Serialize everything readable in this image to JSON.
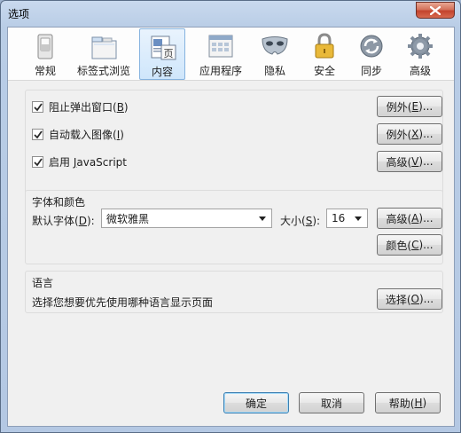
{
  "window": {
    "title": "选项"
  },
  "toolbar": {
    "tabs": [
      {
        "label": "常规"
      },
      {
        "label": "标签式浏览"
      },
      {
        "label": "内容"
      },
      {
        "label": "应用程序"
      },
      {
        "label": "隐私"
      },
      {
        "label": "安全"
      },
      {
        "label": "同步"
      },
      {
        "label": "高级"
      }
    ],
    "selected": "内容"
  },
  "popups": {
    "block_popups": {
      "label_pre": "阻止弹出窗口(",
      "key": "B",
      "label_post": ")",
      "checked": true
    },
    "load_images": {
      "label_pre": "自动载入图像(",
      "key": "I",
      "label_post": ")",
      "checked": true
    },
    "javascript": {
      "label_pre": "启用 ",
      "key": "J",
      "label_post": "avaScript",
      "checked": true
    },
    "exceptions1": {
      "pre": "例外(",
      "key": "E",
      "post": ")..."
    },
    "exceptions2": {
      "pre": "例外(",
      "key": "X",
      "post": ")..."
    },
    "advanced": {
      "pre": "高级(",
      "key": "V",
      "post": ")..."
    }
  },
  "fonts": {
    "title": "字体和颜色",
    "default_font_label": {
      "pre": "默认字体(",
      "key": "D",
      "post": "):"
    },
    "default_font_value": "微软雅黑",
    "size_label": {
      "pre": "大小(",
      "key": "S",
      "post": "):"
    },
    "size_value": "16",
    "advanced": {
      "pre": "高级(",
      "key": "A",
      "post": ")..."
    },
    "colors": {
      "pre": "颜色(",
      "key": "C",
      "post": ")..."
    }
  },
  "language": {
    "title": "语言",
    "description": "选择您想要优先使用哪种语言显示页面",
    "choose": {
      "pre": "选择(",
      "key": "O",
      "post": ")..."
    }
  },
  "footer": {
    "ok": "确定",
    "cancel": "取消",
    "help": {
      "pre": "帮助(",
      "key": "H",
      "post": ")"
    }
  },
  "colors": {
    "accent": "#3c7fb1",
    "selected_tab_bg": "#cfe6fb",
    "close_red": "#c3432d"
  }
}
